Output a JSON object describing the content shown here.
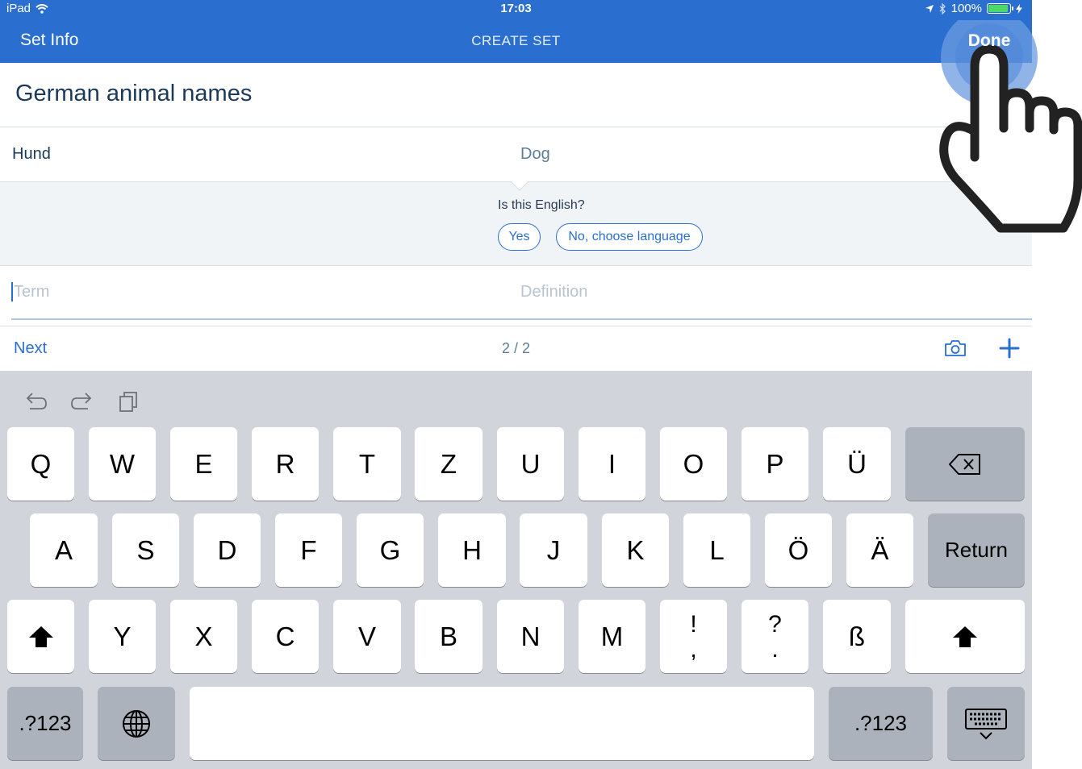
{
  "status_bar": {
    "device": "iPad",
    "time": "17:03",
    "battery": "100%",
    "battery_level": 1.0
  },
  "nav": {
    "back_label": "Set Info",
    "title": "CREATE SET",
    "done_label": "Done"
  },
  "set_title": "German animal names",
  "cards": [
    {
      "term": "Hund",
      "definition": "Dog"
    }
  ],
  "language_prompt": {
    "question": "Is this English?",
    "yes_label": "Yes",
    "no_label": "No, choose language"
  },
  "new_card": {
    "term_placeholder": "Term",
    "definition_placeholder": "Definition"
  },
  "footer": {
    "next_label": "Next",
    "count": "2 / 2"
  },
  "keyboard": {
    "row1": [
      "Q",
      "W",
      "E",
      "R",
      "T",
      "Z",
      "U",
      "I",
      "O",
      "P",
      "Ü"
    ],
    "row2": [
      "A",
      "S",
      "D",
      "F",
      "G",
      "H",
      "J",
      "K",
      "L",
      "Ö",
      "Ä"
    ],
    "return_label": "Return",
    "row3": [
      "Y",
      "X",
      "C",
      "V",
      "B",
      "N",
      "M"
    ],
    "punct1": {
      "top": "!",
      "bottom": ","
    },
    "punct2": {
      "top": "?",
      "bottom": "."
    },
    "eszett": "ß",
    "numbers_label": ".?123"
  },
  "colors": {
    "brand_blue": "#2a6fd0",
    "keyboard_bg": "#d1d5db",
    "dark_key": "#abb2bc"
  }
}
